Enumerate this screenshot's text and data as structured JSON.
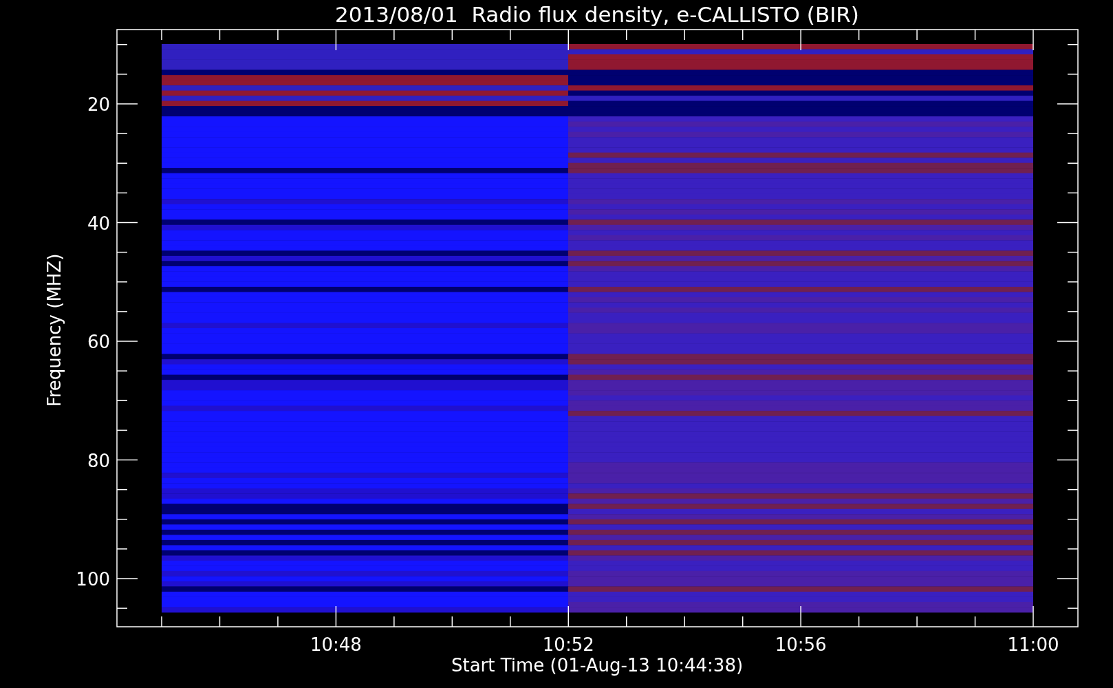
{
  "chart": {
    "title": "2013/08/01  Radio flux density, e-CALLISTO (BIR)",
    "ylabel": "Frequency (MHZ)",
    "xlabel": "Start Time (01-Aug-13 10:44:38)",
    "yticks": [
      "20",
      "40",
      "60",
      "80",
      "100"
    ],
    "xticks": [
      "10:48",
      "10:52",
      "10:56",
      "11:00"
    ]
  }
}
